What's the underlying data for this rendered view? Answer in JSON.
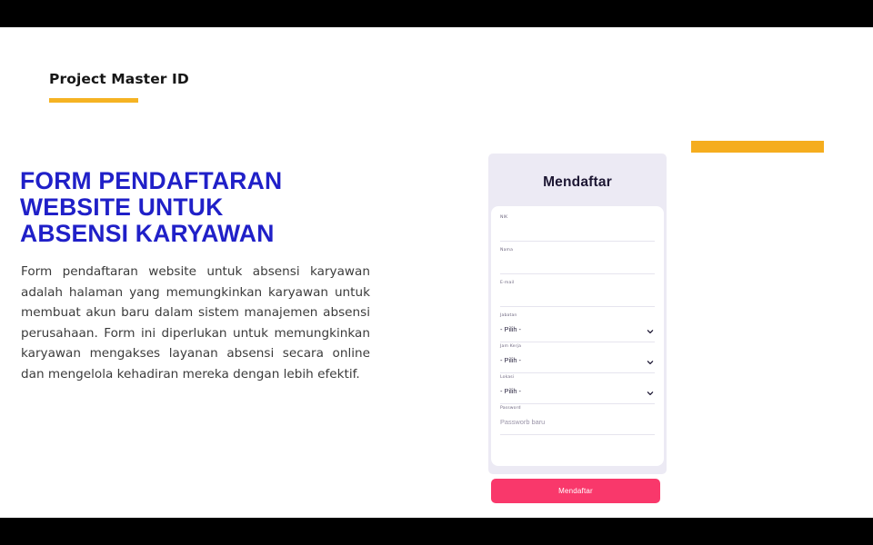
{
  "brand": {
    "title": "Project Master ID"
  },
  "headline": {
    "line1": "FORM PENDAFTARAN",
    "line2": "WEBSITE UNTUK",
    "line3": "ABSENSI KARYAWAN"
  },
  "body": {
    "paragraph": "Form pendaftaran website untuk absensi karyawan adalah halaman yang memungkinkan karyawan untuk membuat akun baru dalam sistem manajemen absensi perusahaan. Form ini diperlukan untuk memungkinkan karyawan mengakses layanan absensi secara online dan mengelola kehadiran mereka dengan lebih efektif."
  },
  "form": {
    "title": "Mendaftar",
    "fields": [
      {
        "label": "NIK",
        "value": "",
        "placeholder": "",
        "type": "text"
      },
      {
        "label": "Nama",
        "value": "",
        "placeholder": "",
        "type": "text"
      },
      {
        "label": "E-mail",
        "value": "",
        "placeholder": "",
        "type": "text"
      },
      {
        "label": "Jabatan",
        "value": "- Pilih -",
        "placeholder": "",
        "type": "select"
      },
      {
        "label": "Jam Kerja",
        "value": "- Pilih -",
        "placeholder": "",
        "type": "select"
      },
      {
        "label": "Lokasi",
        "value": "- Pilih -",
        "placeholder": "",
        "type": "select"
      },
      {
        "label": "Password",
        "value": "",
        "placeholder": "Passworb baru",
        "type": "password"
      }
    ],
    "submit_label": "Mendaftar"
  },
  "colors": {
    "accent_yellow": "#f5ad1e",
    "headline_blue": "#2020c8",
    "button_pink": "#f9386b",
    "card_lavender": "#eceaf4"
  }
}
